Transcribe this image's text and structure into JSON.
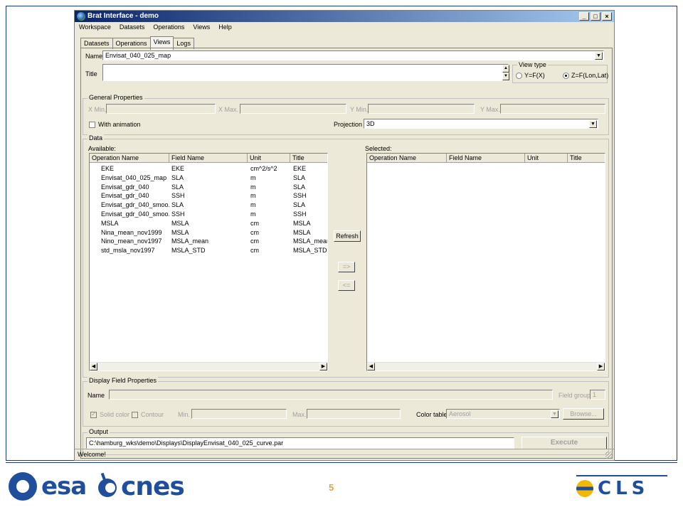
{
  "window": {
    "title": "Brat Interface - demo",
    "controls": [
      "_",
      "□",
      "×"
    ]
  },
  "menu": [
    "Workspace",
    "Datasets",
    "Operations",
    "Views",
    "Help"
  ],
  "tabs": [
    {
      "label": "Datasets",
      "active": false
    },
    {
      "label": "Operations",
      "active": false
    },
    {
      "label": "Views",
      "active": true
    },
    {
      "label": "Logs",
      "active": false
    }
  ],
  "view": {
    "name_label": "Name",
    "name_value": "Envisat_040_025_map",
    "title_label": "Title",
    "title_value": "",
    "view_type": {
      "title": "View type",
      "option_yfx": "Y=F(X)",
      "option_zf": "Z=F(Lon,Lat)",
      "selected": "Z=F(Lon,Lat)"
    }
  },
  "general": {
    "title": "General Properties",
    "xmin_label": "X Min.",
    "xmax_label": "X Max.",
    "ymin_label": "Y Min.",
    "ymax_label": "Y Max.",
    "animation_label": "With animation",
    "projection_label": "Projection",
    "projection_value": "3D"
  },
  "data": {
    "title": "Data",
    "available_label": "Available:",
    "selected_label": "Selected:",
    "available_columns": [
      "Operation Name",
      "Field Name",
      "Unit",
      "Title"
    ],
    "selected_columns": [
      "Operation Name",
      "Field Name",
      "Unit",
      "Title"
    ],
    "available_rows": [
      [
        "EKE",
        "EKE",
        "cm^2/s^2",
        "EKE"
      ],
      [
        "Envisat_040_025_map",
        "SLA",
        "m",
        "SLA"
      ],
      [
        "Envisat_gdr_040",
        "SLA",
        "m",
        "SLA"
      ],
      [
        "Envisat_gdr_040",
        "SSH",
        "m",
        "SSH"
      ],
      [
        "Envisat_gdr_040_smoo...",
        "SLA",
        "m",
        "SLA"
      ],
      [
        "Envisat_gdr_040_smoo...",
        "SSH",
        "m",
        "SSH"
      ],
      [
        "MSLA",
        "MSLA",
        "cm",
        "MSLA"
      ],
      [
        "Nina_mean_nov1999",
        "MSLA",
        "cm",
        "MSLA"
      ],
      [
        "Nino_mean_nov1997",
        "MSLA_mean",
        "cm",
        "MSLA_mean"
      ],
      [
        "std_msla_nov1997",
        "MSLA_STD",
        "cm",
        "MSLA_STD"
      ]
    ],
    "refresh_label": "Refresh",
    "add_label": "=>",
    "remove_label": "<="
  },
  "display": {
    "title": "Display Field Properties",
    "name_label": "Name",
    "field_group_label": "Field group",
    "field_group_value": "1",
    "solid_color_label": "Solid color",
    "contour_label": "Contour",
    "min_label": "Min.",
    "max_label": "Max.",
    "color_table_label": "Color table",
    "color_table_value": "Aerosol",
    "browse_label": "Browse..."
  },
  "output": {
    "title": "Output",
    "path": "C:\\hamburg_wks\\demo\\Displays\\DisplayEnvisat_040_025_curve.par",
    "execute_label": "Execute"
  },
  "status": "Welcome!",
  "footer": {
    "esa": "esa",
    "cnes": "cnes",
    "page": "5",
    "cls": "CLS"
  },
  "colors": {
    "titlebar_start": "#0a246a",
    "brand_blue": "#1f4e9c",
    "page_number": "#e8a23a"
  }
}
